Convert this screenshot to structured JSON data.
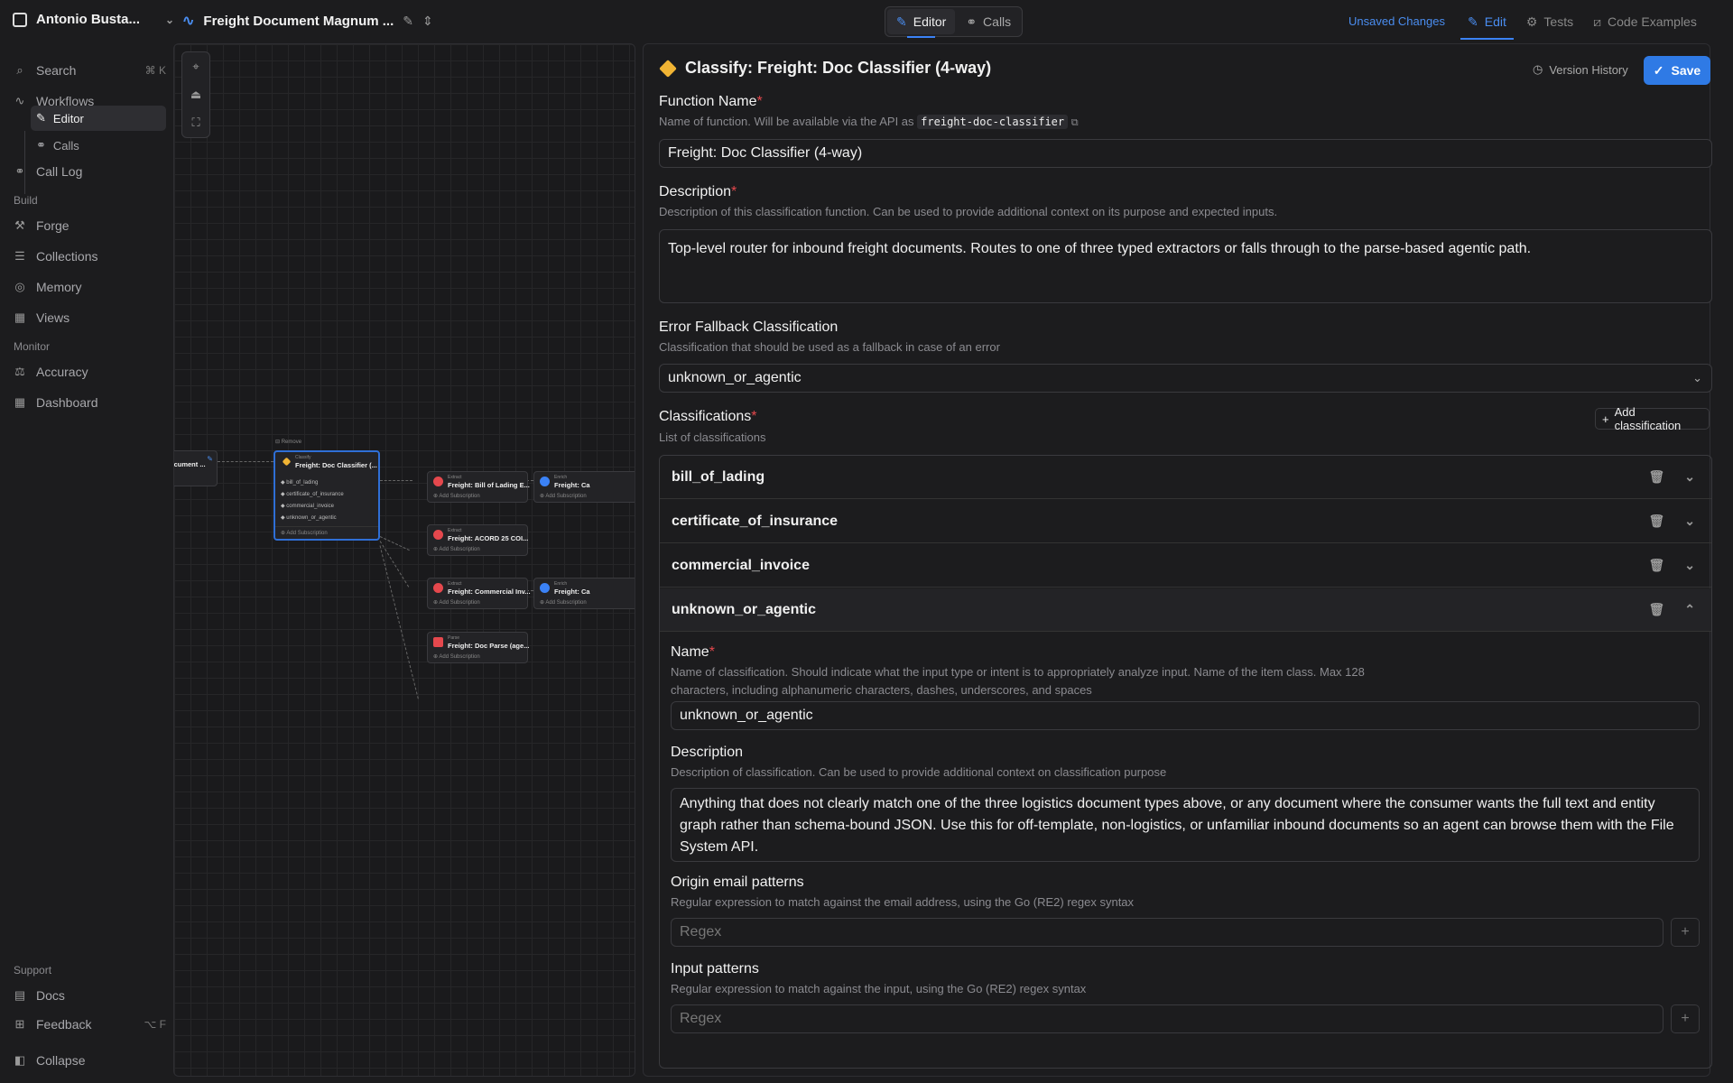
{
  "topbar": {
    "workspace": "Antonio Busta...",
    "workflow_name": "Freight Document Magnum ...",
    "modes": [
      "Editor",
      "Calls"
    ],
    "unsaved": "Unsaved Changes",
    "tabs": [
      "Edit",
      "Tests",
      "Code Examples"
    ]
  },
  "sidebar": {
    "search": "Search",
    "search_kbd": "⌘ K",
    "workflows": "Workflows",
    "editor": "Editor",
    "calls": "Calls",
    "call_log": "Call Log",
    "build_section": "Build",
    "forge": "Forge",
    "collections": "Collections",
    "memory": "Memory",
    "views": "Views",
    "monitor_section": "Monitor",
    "accuracy": "Accuracy",
    "dashboard": "Dashboard",
    "support_section": "Support",
    "docs": "Docs",
    "feedback": "Feedback",
    "feedback_kbd": "⌥ F",
    "collapse": "Collapse"
  },
  "canvas": {
    "left_node": "ocument ...",
    "remove": "Remove",
    "classify_type": "Classify",
    "classify_name": "Freight: Doc Classifier (...",
    "classify_rows": [
      "bill_of_lading",
      "certificate_of_insurance",
      "commercial_invoice",
      "unknown_or_agentic"
    ],
    "add_subscription": "Add Subscription",
    "extract_type": "Extract",
    "enrich_type": "Enrich",
    "parse_type": "Parse",
    "extract1": "Freight: Bill of Lading E...",
    "extract2": "Freight: ACORD 25 COI...",
    "extract3": "Freight: Commercial Inv...",
    "parse1": "Freight: Doc Parse (age...",
    "enrich1": "Freight: Ca",
    "enrich2": "Freight: Ca"
  },
  "panel": {
    "title": "Classify: Freight: Doc Classifier (4-way)",
    "version_history": "Version History",
    "save": "Save",
    "function_name_label": "Function Name",
    "function_name_hint": "Name of function. Will be available via the API as",
    "function_api_name": "freight-doc-classifier",
    "function_name_value": "Freight: Doc Classifier (4-way)",
    "description_label": "Description",
    "description_hint": "Description of this classification function. Can be used to provide additional context on its purpose and expected inputs.",
    "description_value": "Top-level router for inbound freight documents. Routes to one of three typed extractors or falls through to the parse-based agentic path.",
    "fallback_label": "Error Fallback Classification",
    "fallback_hint": "Classification that should be used as a fallback in case of an error",
    "fallback_value": "unknown_or_agentic",
    "classifications_label": "Classifications",
    "classifications_hint": "List of classifications",
    "add_classification": "Add classification",
    "classifications": [
      "bill_of_lading",
      "certificate_of_insurance",
      "commercial_invoice",
      "unknown_or_agentic"
    ],
    "expanded": {
      "name_label": "Name",
      "name_hint_1": "Name of classification. Should indicate what the input type or intent is to appropriately analyze input. Name of the item class. Max 128",
      "name_hint_2": "characters, including alphanumeric characters, dashes, underscores, and spaces",
      "name_value": "unknown_or_agentic",
      "desc_label": "Description",
      "desc_hint": "Description of classification. Can be used to provide additional context on classification purpose",
      "desc_value": "Anything that does not clearly match one of the three logistics document types above, or any document where the consumer wants the full text and entity graph rather than schema-bound JSON. Use this for off-template, non-logistics, or unfamiliar inbound documents so an agent can browse them with the File System API.",
      "email_label": "Origin email patterns",
      "email_hint": "Regular expression to match against the email address, using the Go (RE2) regex syntax",
      "email_placeholder": "Regex",
      "input_label": "Input patterns",
      "input_hint": "Regular expression to match against the input, using the Go (RE2) regex syntax",
      "input_placeholder": "Regex"
    }
  }
}
